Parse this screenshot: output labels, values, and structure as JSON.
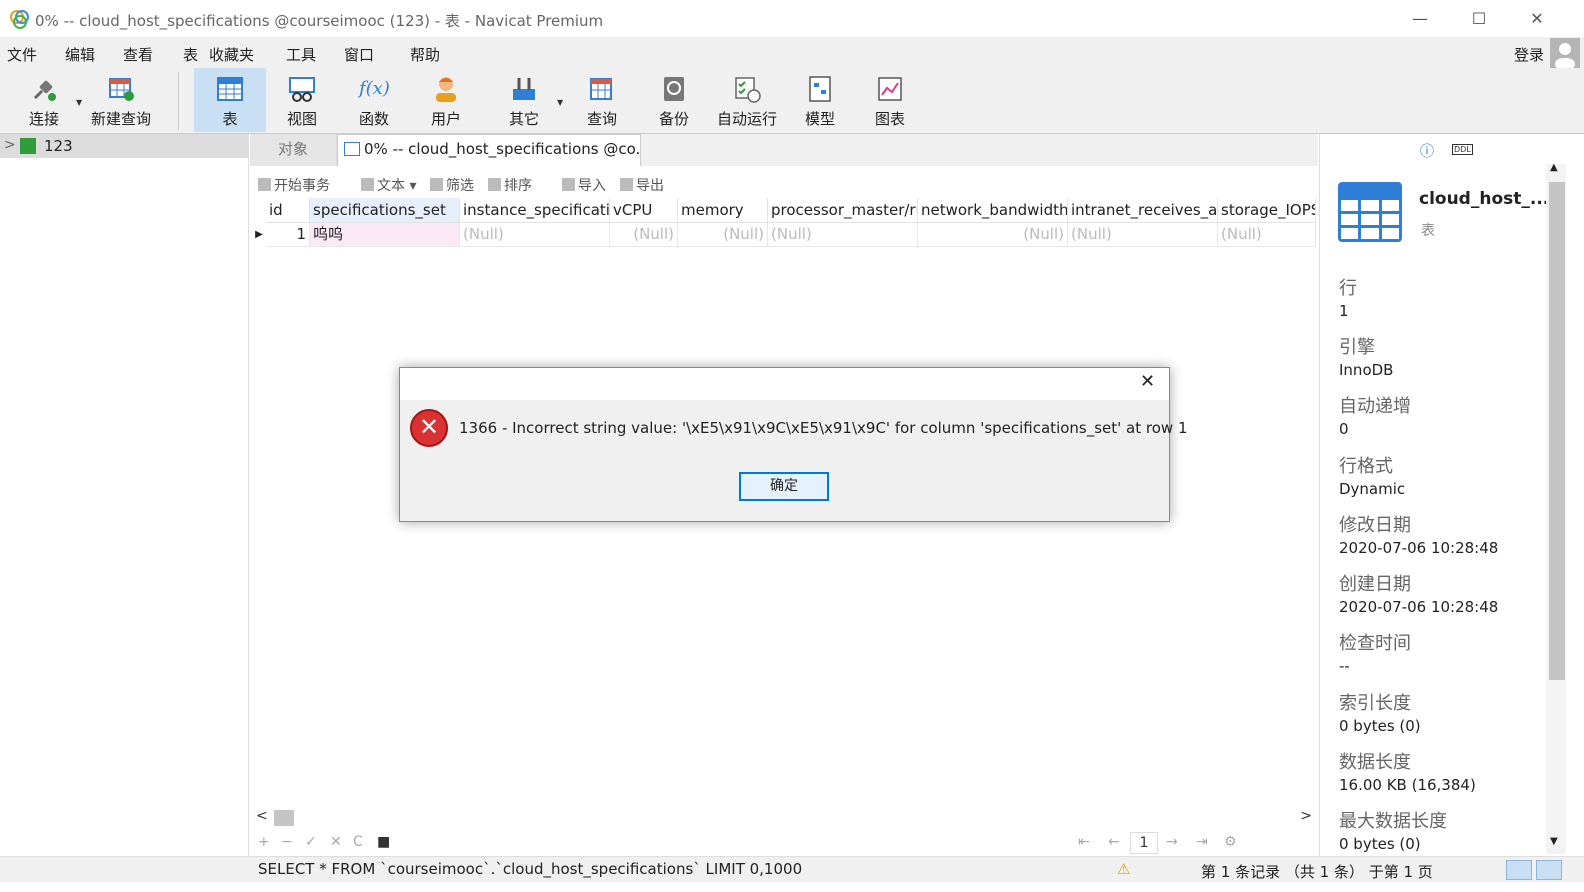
{
  "window": {
    "title": "0% -- cloud_host_specifications @courseimooc (123) - 表 - Navicat Premium",
    "controls": {
      "minimize": "—",
      "maximize": "☐",
      "close": "✕"
    }
  },
  "menu": {
    "items": [
      "文件",
      "编辑",
      "查看",
      "表",
      "收藏夹",
      "工具",
      "窗口",
      "帮助"
    ],
    "login": "登录"
  },
  "toolbar": {
    "buttons": [
      {
        "label": "连接",
        "icon": "plug-icon"
      },
      {
        "label": "新建查询",
        "icon": "new-query-icon"
      },
      {
        "label": "表",
        "icon": "table-icon",
        "active": true
      },
      {
        "label": "视图",
        "icon": "view-icon"
      },
      {
        "label": "函数",
        "icon": "function-icon"
      },
      {
        "label": "用户",
        "icon": "user-icon"
      },
      {
        "label": "其它",
        "icon": "tools-icon"
      },
      {
        "label": "查询",
        "icon": "query-icon"
      },
      {
        "label": "备份",
        "icon": "backup-icon"
      },
      {
        "label": "自动运行",
        "icon": "autorun-icon"
      },
      {
        "label": "模型",
        "icon": "model-icon"
      },
      {
        "label": "图表",
        "icon": "chart-icon"
      }
    ],
    "function_glyph": "f(x)"
  },
  "tree": {
    "arrow": ">",
    "connection": "123"
  },
  "tabs": {
    "objects": "对象",
    "active": "0% -- cloud_host_specifications @co..."
  },
  "subtoolbar": {
    "begin_transaction": "开始事务",
    "text": "文本",
    "filter": "筛选",
    "sort": "排序",
    "import": "导入",
    "export": "导出"
  },
  "grid": {
    "columns": [
      "id",
      "specifications_set",
      "instance_specificatio",
      "vCPU",
      "memory",
      "processor_master/ru",
      "network_bandwidth",
      "intranet_receives_an",
      "storage_IOPS"
    ],
    "row": [
      "1",
      "呜呜",
      "(Null)",
      "(Null)",
      "(Null)",
      "(Null)",
      "(Null)",
      "(Null)",
      "(Null)"
    ],
    "row_marker": "▶"
  },
  "pagination": {
    "add": "+",
    "remove": "−",
    "apply": "✓",
    "discard": "✕",
    "refresh": "C",
    "stop": "■",
    "first": "⇤",
    "prev": "←",
    "page": "1",
    "next": "→",
    "last": "⇥",
    "settings": "⚙"
  },
  "statusbar": {
    "sql": "SELECT * FROM `courseimooc`.`cloud_host_specifications` LIMIT 0,1000",
    "warning": "⚠",
    "records": "第 1 条记录 （共 1 条） 于第 1 页"
  },
  "info_panel": {
    "info_icon": "ⓘ",
    "ddl_icon": "DDL",
    "name": "cloud_host_...",
    "type": "表",
    "properties": [
      {
        "key": "行",
        "value": "1"
      },
      {
        "key": "引擎",
        "value": "InnoDB"
      },
      {
        "key": "自动递增",
        "value": "0"
      },
      {
        "key": "行格式",
        "value": "Dynamic"
      },
      {
        "key": "修改日期",
        "value": "2020-07-06 10:28:48"
      },
      {
        "key": "创建日期",
        "value": "2020-07-06 10:28:48"
      },
      {
        "key": "检查时间",
        "value": "--"
      },
      {
        "key": "索引长度",
        "value": "0 bytes (0)"
      },
      {
        "key": "数据长度",
        "value": "16.00 KB (16,384)"
      },
      {
        "key": "最大数据长度",
        "value": "0 bytes (0)"
      }
    ]
  },
  "dialog": {
    "message": "1366 - Incorrect string value: '\\xE5\\x91\\x9C\\xE5\\x91\\x9C' for column 'specifications_set' at row 1",
    "ok": "确定",
    "close": "✕",
    "error_glyph": "✕"
  },
  "colors": {
    "accent": "#0078d7",
    "active_tool": "#c9dff3",
    "error": "#d83232"
  }
}
